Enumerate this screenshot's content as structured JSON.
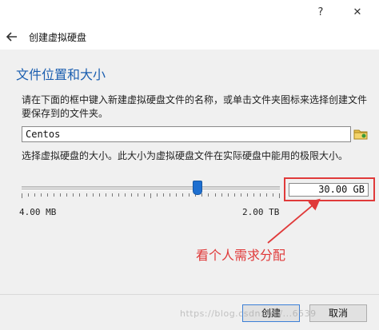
{
  "titlebar": {
    "help_icon": "?",
    "close_icon": "✕"
  },
  "header": {
    "title": "创建虚拟硬盘"
  },
  "section": {
    "title": "文件位置和大小"
  },
  "location": {
    "description": "请在下面的框中键入新建虚拟硬盘文件的名称，或单击文件夹图标来选择创建文件要保存到的文件夹。",
    "value": "Centos"
  },
  "size": {
    "description": "选择虚拟硬盘的大小。此大小为虚拟硬盘文件在实际硬盘中能用的极限大小。",
    "min_label": "4.00 MB",
    "max_label": "2.00 TB",
    "value": "30.00 GB",
    "slider_fraction": 0.68
  },
  "annotation": {
    "text": "看个人需求分配",
    "color": "#e03a3a"
  },
  "footer": {
    "create_label": "创建",
    "cancel_label": "取消"
  },
  "watermark": "https://blog.csdn.net/...6539",
  "colors": {
    "section_title": "#1c5fb0",
    "slider_handle": "#1e6fd0"
  }
}
